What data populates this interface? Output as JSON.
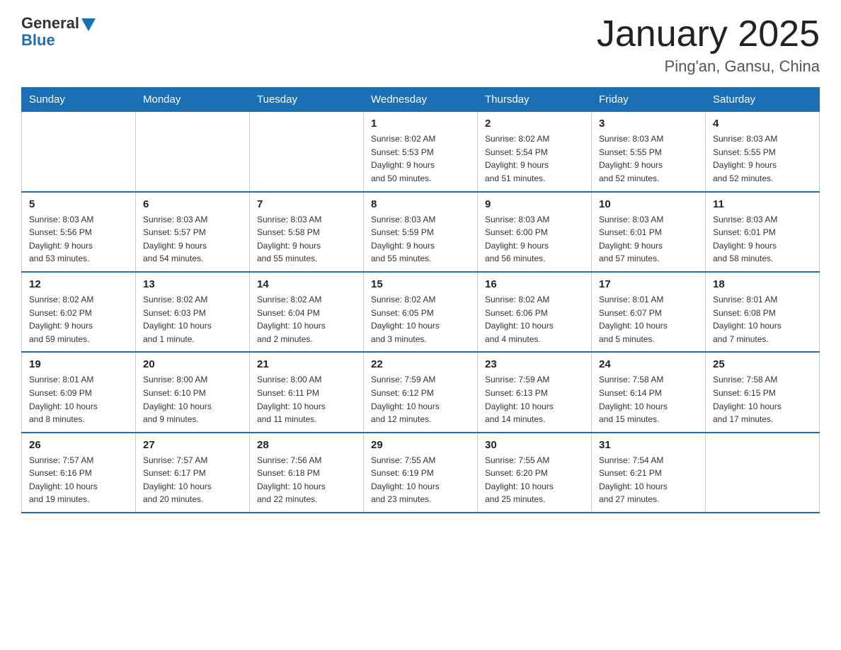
{
  "logo": {
    "general": "General",
    "blue": "Blue"
  },
  "title": "January 2025",
  "location": "Ping'an, Gansu, China",
  "days_of_week": [
    "Sunday",
    "Monday",
    "Tuesday",
    "Wednesday",
    "Thursday",
    "Friday",
    "Saturday"
  ],
  "weeks": [
    [
      {
        "day": "",
        "info": ""
      },
      {
        "day": "",
        "info": ""
      },
      {
        "day": "",
        "info": ""
      },
      {
        "day": "1",
        "info": "Sunrise: 8:02 AM\nSunset: 5:53 PM\nDaylight: 9 hours\nand 50 minutes."
      },
      {
        "day": "2",
        "info": "Sunrise: 8:02 AM\nSunset: 5:54 PM\nDaylight: 9 hours\nand 51 minutes."
      },
      {
        "day": "3",
        "info": "Sunrise: 8:03 AM\nSunset: 5:55 PM\nDaylight: 9 hours\nand 52 minutes."
      },
      {
        "day": "4",
        "info": "Sunrise: 8:03 AM\nSunset: 5:55 PM\nDaylight: 9 hours\nand 52 minutes."
      }
    ],
    [
      {
        "day": "5",
        "info": "Sunrise: 8:03 AM\nSunset: 5:56 PM\nDaylight: 9 hours\nand 53 minutes."
      },
      {
        "day": "6",
        "info": "Sunrise: 8:03 AM\nSunset: 5:57 PM\nDaylight: 9 hours\nand 54 minutes."
      },
      {
        "day": "7",
        "info": "Sunrise: 8:03 AM\nSunset: 5:58 PM\nDaylight: 9 hours\nand 55 minutes."
      },
      {
        "day": "8",
        "info": "Sunrise: 8:03 AM\nSunset: 5:59 PM\nDaylight: 9 hours\nand 55 minutes."
      },
      {
        "day": "9",
        "info": "Sunrise: 8:03 AM\nSunset: 6:00 PM\nDaylight: 9 hours\nand 56 minutes."
      },
      {
        "day": "10",
        "info": "Sunrise: 8:03 AM\nSunset: 6:01 PM\nDaylight: 9 hours\nand 57 minutes."
      },
      {
        "day": "11",
        "info": "Sunrise: 8:03 AM\nSunset: 6:01 PM\nDaylight: 9 hours\nand 58 minutes."
      }
    ],
    [
      {
        "day": "12",
        "info": "Sunrise: 8:02 AM\nSunset: 6:02 PM\nDaylight: 9 hours\nand 59 minutes."
      },
      {
        "day": "13",
        "info": "Sunrise: 8:02 AM\nSunset: 6:03 PM\nDaylight: 10 hours\nand 1 minute."
      },
      {
        "day": "14",
        "info": "Sunrise: 8:02 AM\nSunset: 6:04 PM\nDaylight: 10 hours\nand 2 minutes."
      },
      {
        "day": "15",
        "info": "Sunrise: 8:02 AM\nSunset: 6:05 PM\nDaylight: 10 hours\nand 3 minutes."
      },
      {
        "day": "16",
        "info": "Sunrise: 8:02 AM\nSunset: 6:06 PM\nDaylight: 10 hours\nand 4 minutes."
      },
      {
        "day": "17",
        "info": "Sunrise: 8:01 AM\nSunset: 6:07 PM\nDaylight: 10 hours\nand 5 minutes."
      },
      {
        "day": "18",
        "info": "Sunrise: 8:01 AM\nSunset: 6:08 PM\nDaylight: 10 hours\nand 7 minutes."
      }
    ],
    [
      {
        "day": "19",
        "info": "Sunrise: 8:01 AM\nSunset: 6:09 PM\nDaylight: 10 hours\nand 8 minutes."
      },
      {
        "day": "20",
        "info": "Sunrise: 8:00 AM\nSunset: 6:10 PM\nDaylight: 10 hours\nand 9 minutes."
      },
      {
        "day": "21",
        "info": "Sunrise: 8:00 AM\nSunset: 6:11 PM\nDaylight: 10 hours\nand 11 minutes."
      },
      {
        "day": "22",
        "info": "Sunrise: 7:59 AM\nSunset: 6:12 PM\nDaylight: 10 hours\nand 12 minutes."
      },
      {
        "day": "23",
        "info": "Sunrise: 7:59 AM\nSunset: 6:13 PM\nDaylight: 10 hours\nand 14 minutes."
      },
      {
        "day": "24",
        "info": "Sunrise: 7:58 AM\nSunset: 6:14 PM\nDaylight: 10 hours\nand 15 minutes."
      },
      {
        "day": "25",
        "info": "Sunrise: 7:58 AM\nSunset: 6:15 PM\nDaylight: 10 hours\nand 17 minutes."
      }
    ],
    [
      {
        "day": "26",
        "info": "Sunrise: 7:57 AM\nSunset: 6:16 PM\nDaylight: 10 hours\nand 19 minutes."
      },
      {
        "day": "27",
        "info": "Sunrise: 7:57 AM\nSunset: 6:17 PM\nDaylight: 10 hours\nand 20 minutes."
      },
      {
        "day": "28",
        "info": "Sunrise: 7:56 AM\nSunset: 6:18 PM\nDaylight: 10 hours\nand 22 minutes."
      },
      {
        "day": "29",
        "info": "Sunrise: 7:55 AM\nSunset: 6:19 PM\nDaylight: 10 hours\nand 23 minutes."
      },
      {
        "day": "30",
        "info": "Sunrise: 7:55 AM\nSunset: 6:20 PM\nDaylight: 10 hours\nand 25 minutes."
      },
      {
        "day": "31",
        "info": "Sunrise: 7:54 AM\nSunset: 6:21 PM\nDaylight: 10 hours\nand 27 minutes."
      },
      {
        "day": "",
        "info": ""
      }
    ]
  ]
}
